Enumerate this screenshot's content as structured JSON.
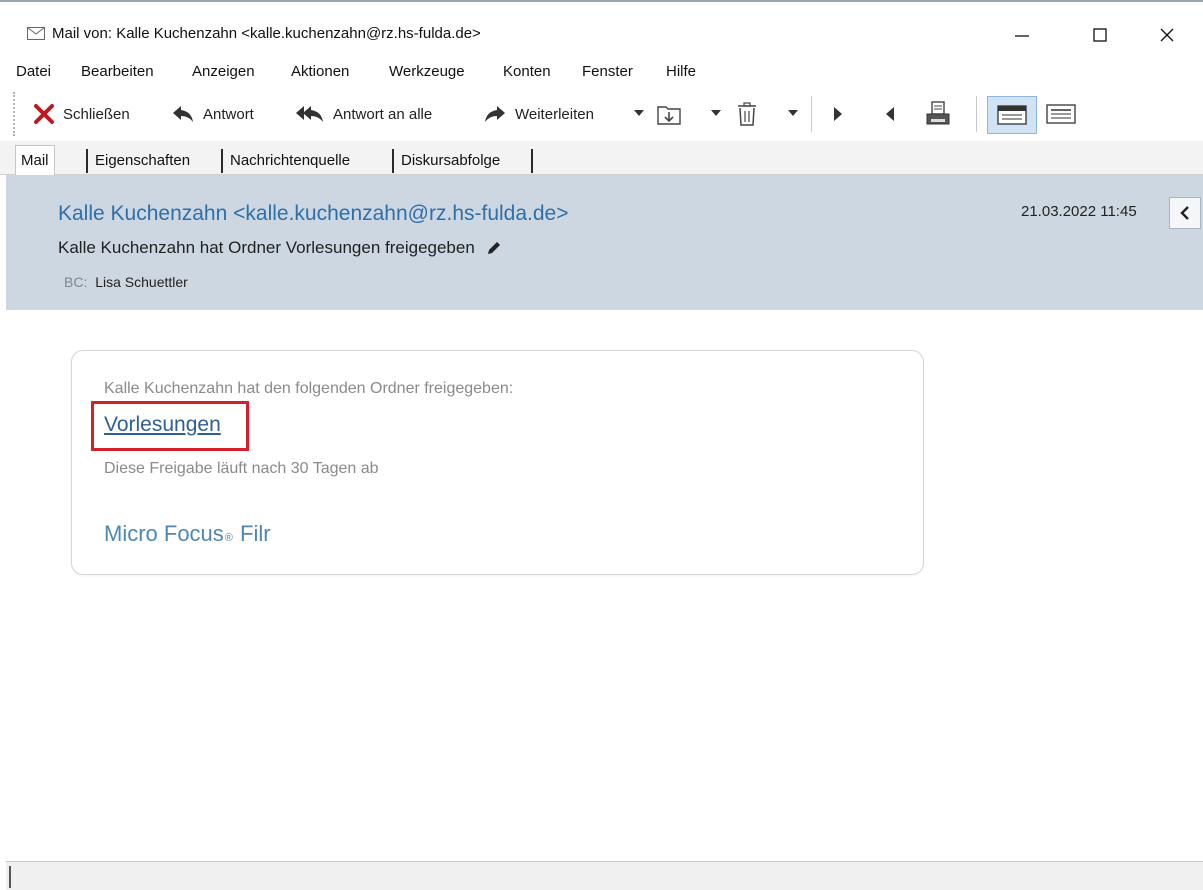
{
  "window": {
    "title": "Mail von: Kalle Kuchenzahn <kalle.kuchenzahn@rz.hs-fulda.de>",
    "title_icon": "envelope-icon",
    "controls": [
      "minimize-icon",
      "maximize-icon",
      "close-icon"
    ]
  },
  "menu": {
    "items": [
      "Datei",
      "Bearbeiten",
      "Anzeigen",
      "Aktionen",
      "Werkzeuge",
      "Konten",
      "Fenster",
      "Hilfe"
    ]
  },
  "toolbar": {
    "close_label": "Schließen",
    "reply_label": "Antwort",
    "reply_all_label": "Antwort an alle",
    "forward_label": "Weiterleiten",
    "icons": [
      "close-x-icon",
      "reply-icon",
      "reply-all-icon",
      "forward-icon",
      "save-to-folder-icon",
      "trash-icon",
      "next-icon",
      "previous-icon",
      "print-icon",
      "view-mode-1-icon",
      "view-mode-2-icon"
    ],
    "accent_close": "#c0181e"
  },
  "tabs": [
    {
      "label": "Mail",
      "active": true
    },
    {
      "label": "Eigenschaften",
      "active": false
    },
    {
      "label": "Nachrichtenquelle",
      "active": false
    },
    {
      "label": "Diskursabfolge",
      "active": false
    }
  ],
  "message_header": {
    "from": "Kalle Kuchenzahn <kalle.kuchenzahn@rz.hs-fulda.de>",
    "subject": "Kalle Kuchenzahn hat Ordner Vorlesungen freigegeben",
    "bc_label": "BC:",
    "bc_value": "Lisa Schuettler",
    "date": "21.03.2022 11:45",
    "background": "#ccd7e2",
    "from_color": "#2f6fa8"
  },
  "message_body": {
    "intro": "Kalle Kuchenzahn hat den folgenden Ordner freigegeben:",
    "folder_link": "Vorlesungen",
    "expiry": "Diese Freigabe läuft nach 30 Tagen ab",
    "brand_part1": "Micro Focus",
    "brand_reg": "®",
    "brand_part2": " Filr",
    "highlight_color": "#d4202a"
  }
}
